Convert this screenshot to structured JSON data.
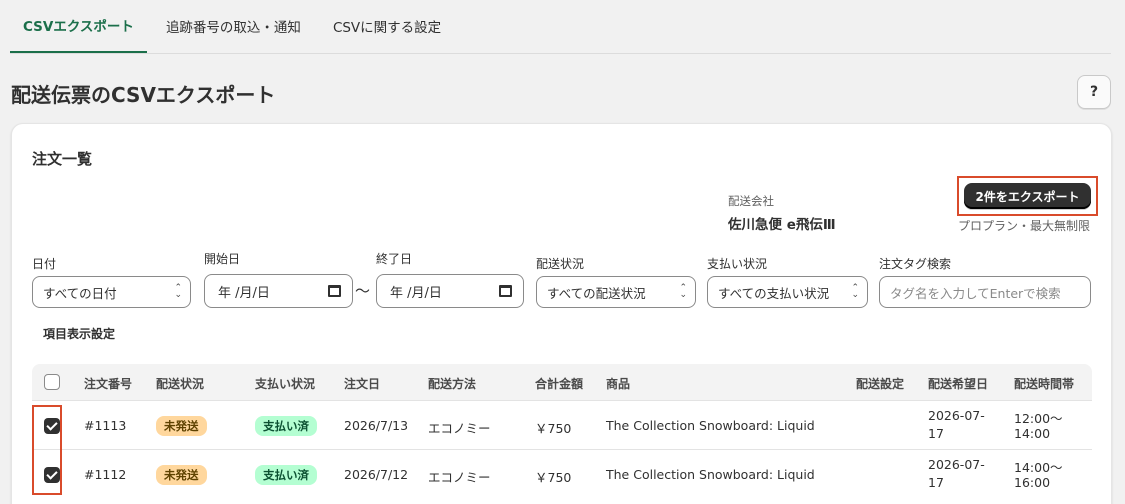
{
  "tabs": [
    {
      "label": "CSVエクスポート"
    },
    {
      "label": "追跡番号の取込・通知"
    },
    {
      "label": "CSVに関する設定"
    }
  ],
  "page": {
    "title": "配送伝票のCSVエクスポート",
    "help_label": "?"
  },
  "card": {
    "title": "注文一覧",
    "carrier_label": "配送会社",
    "carrier_value": "佐川急便 e飛伝Ⅲ",
    "export_label": "2件をエクスポート",
    "plan_note": "プロプラン・最大無制限"
  },
  "filters": {
    "date_label": "日付",
    "date_value": "すべての日付",
    "start_label": "開始日",
    "start_value": "年 /月/日",
    "end_label": "終了日",
    "end_value": "年 /月/日",
    "tilde": "〜",
    "shipping_label": "配送状況",
    "shipping_value": "すべての配送状況",
    "payment_label": "支払い状況",
    "payment_value": "すべての支払い状況",
    "tag_label": "注文タグ検索",
    "tag_placeholder": "タグ名を入力してEnterで検索"
  },
  "column_settings": "項目表示設定",
  "table": {
    "headers": {
      "order": "注文番号",
      "shipping": "配送状況",
      "payment": "支払い状況",
      "date": "注文日",
      "method": "配送方法",
      "total": "合計金額",
      "product": "商品",
      "setting": "配送設定",
      "desired_date": "配送希望日",
      "time_slot": "配送時間帯"
    },
    "rows": [
      {
        "checked": true,
        "order": "#1113",
        "shipping": "未発送",
        "payment": "支払い済",
        "date": "2026/7/13",
        "method": "エコノミー",
        "total": "￥750",
        "product": "The Collection Snowboard: Liquid",
        "desired_1": "2026-07-",
        "desired_2": "17",
        "time_1": "12:00〜",
        "time_2": "14:00"
      },
      {
        "checked": true,
        "order": "#1112",
        "shipping": "未発送",
        "payment": "支払い済",
        "date": "2026/7/12",
        "method": "エコノミー",
        "total": "￥750",
        "product": "The Collection Snowboard: Liquid",
        "desired_1": "2026-07-",
        "desired_2": "17",
        "time_1": "14:00〜",
        "time_2": "16:00"
      }
    ]
  }
}
